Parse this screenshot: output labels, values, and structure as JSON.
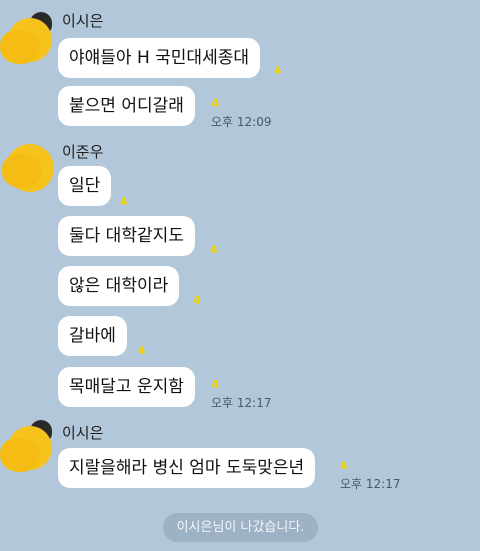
{
  "messages": [
    {
      "sender": "이시은",
      "lines": [
        {
          "text": "야얘들아 H 국민대세종대",
          "unread": "4"
        },
        {
          "text": "붙으면 어디갈래",
          "unread": "4",
          "time": "오후 12:09"
        }
      ]
    },
    {
      "sender": "이준우",
      "lines": [
        {
          "text": "일단",
          "unread": "4"
        },
        {
          "text": "둘다 대학같지도",
          "unread": "4"
        },
        {
          "text": "않은 대학이라",
          "unread": "4"
        },
        {
          "text": "갈바에",
          "unread": "4"
        },
        {
          "text": "목매달고 운지함",
          "unread": "4",
          "time": "오후 12:17"
        }
      ]
    },
    {
      "sender": "이시은",
      "lines": [
        {
          "text": "지랄을해라 병신 엄마 도둑맞은년",
          "unread": "4",
          "time": "오후 12:17"
        }
      ]
    }
  ],
  "system_notice": "이시은님이 나갔습니다.",
  "colors": {
    "background": "#b2c7d9",
    "bubble": "#ffffff",
    "unread": "#f2d200",
    "avatar": "#f6c21c"
  }
}
